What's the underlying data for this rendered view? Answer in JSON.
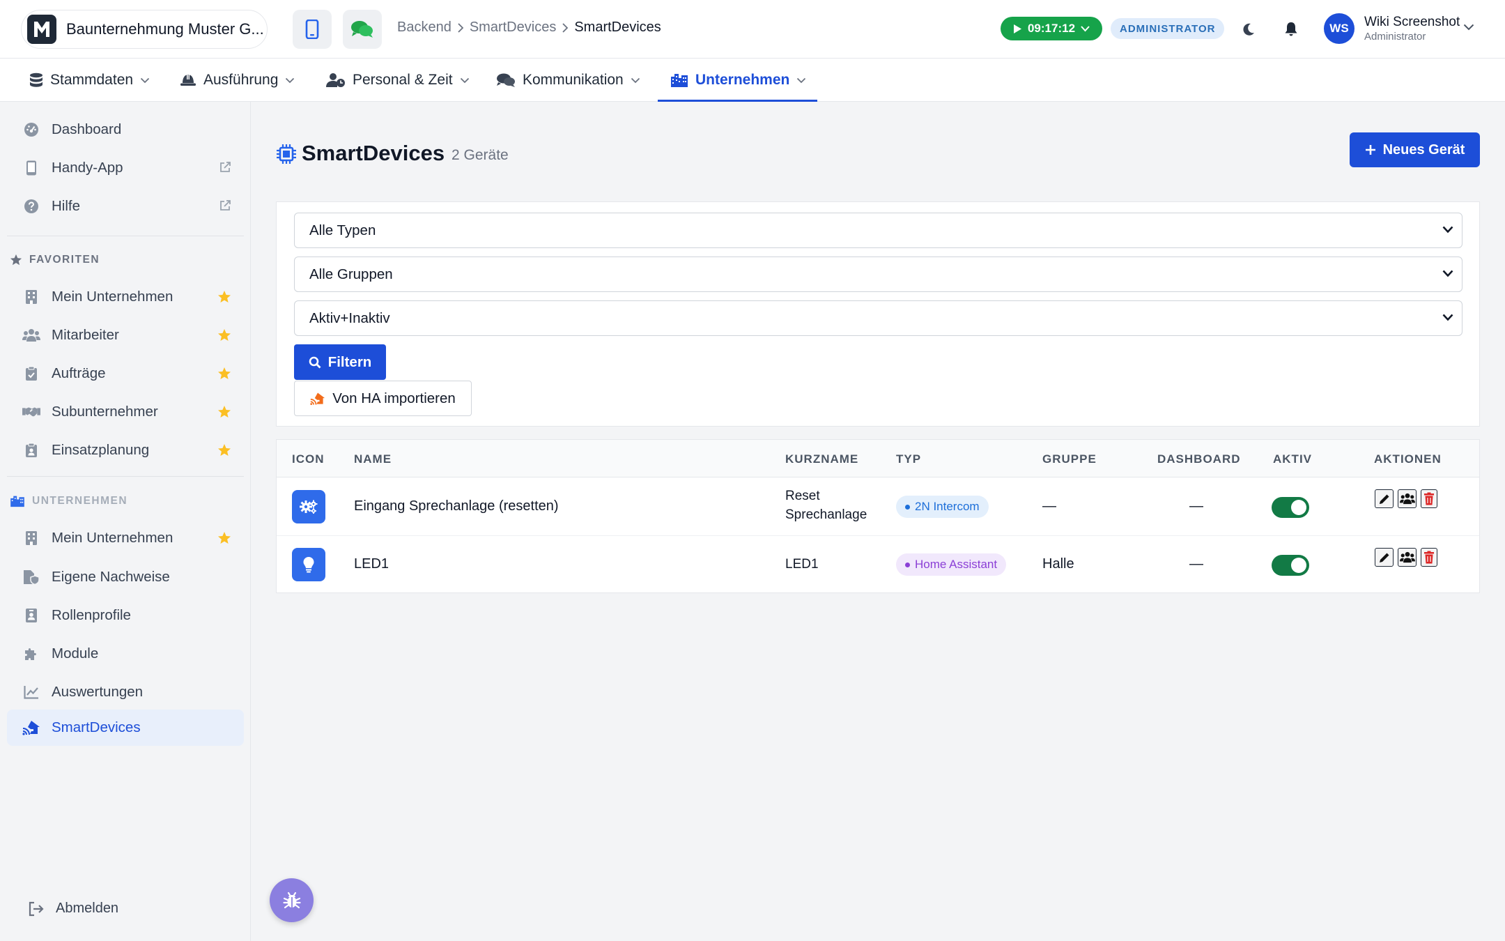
{
  "header": {
    "company_name": "Baunternehmung Muster G...",
    "breadcrumb": [
      "Backend",
      "SmartDevices",
      "SmartDevices"
    ],
    "timer": "09:17:12",
    "role_badge": "ADMINISTRATOR",
    "user_initials": "WS",
    "user_name": "Wiki Screenshot",
    "user_role": "Administrator"
  },
  "nav": {
    "items": [
      {
        "label": "Stammdaten",
        "icon": "database-icon"
      },
      {
        "label": "Ausführung",
        "icon": "hardhat-icon"
      },
      {
        "label": "Personal & Zeit",
        "icon": "user-clock-icon"
      },
      {
        "label": "Kommunikation",
        "icon": "comments-icon"
      },
      {
        "label": "Unternehmen",
        "icon": "city-icon",
        "active": true
      }
    ]
  },
  "sidebar": {
    "top_items": [
      {
        "label": "Dashboard",
        "icon": "gauge-icon"
      },
      {
        "label": "Handy-App",
        "icon": "mobile-icon",
        "external": true
      },
      {
        "label": "Hilfe",
        "icon": "question-icon",
        "external": true
      }
    ],
    "favorites_title": "FAVORITEN",
    "favorites": [
      {
        "label": "Mein Unternehmen",
        "icon": "building-icon"
      },
      {
        "label": "Mitarbeiter",
        "icon": "users-icon"
      },
      {
        "label": "Aufträge",
        "icon": "clipboard-icon"
      },
      {
        "label": "Subunternehmer",
        "icon": "handshake-icon"
      },
      {
        "label": "Einsatzplanung",
        "icon": "clipboard-user-icon"
      }
    ],
    "company_title": "UNTERNEHMEN",
    "company_items": [
      {
        "label": "Mein Unternehmen",
        "icon": "building-icon",
        "favorite": true
      },
      {
        "label": "Eigene Nachweise",
        "icon": "file-shield-icon"
      },
      {
        "label": "Rollenprofile",
        "icon": "id-badge-icon"
      },
      {
        "label": "Module",
        "icon": "puzzle-icon"
      },
      {
        "label": "Auswertungen",
        "icon": "chart-line-icon"
      },
      {
        "label": "SmartDevices",
        "icon": "house-signal-icon",
        "active": true
      }
    ],
    "logout": "Abmelden"
  },
  "page": {
    "title": "SmartDevices",
    "count": "2 Geräte",
    "new_button": "Neues Gerät"
  },
  "filters": {
    "type_select": "Alle Typen",
    "group_select": "Alle Gruppen",
    "status_select": "Aktiv+Inaktiv",
    "filter_button": "Filtern",
    "import_button": "Von HA importieren"
  },
  "table": {
    "headers": [
      "ICON",
      "NAME",
      "KURZNAME",
      "TYP",
      "GRUPPE",
      "DASHBOARD",
      "AKTIV",
      "AKTIONEN"
    ],
    "rows": [
      {
        "icon": "gears-icon",
        "name": "Eingang Sprechanlage (resetten)",
        "short_name_line1": "Reset",
        "short_name_line2": "Sprechanlage",
        "type": "2N Intercom",
        "type_color": "#1e6fd9",
        "type_bg": "#e3effc",
        "group": "—",
        "dashboard": "—",
        "active": true
      },
      {
        "icon": "lightbulb-icon",
        "name": "LED1",
        "short_name_line1": "LED1",
        "short_name_line2": "",
        "type": "Home Assistant",
        "type_color": "#8b3fd6",
        "type_bg": "#f1e8fc",
        "group": "Halle",
        "dashboard": "—",
        "active": true
      }
    ]
  },
  "colors": {
    "primary": "#1d4ed8",
    "timer_green": "#16a34a",
    "toggle_green": "#127a45",
    "star": "#fbbf24",
    "delete_red": "#dc2626"
  }
}
